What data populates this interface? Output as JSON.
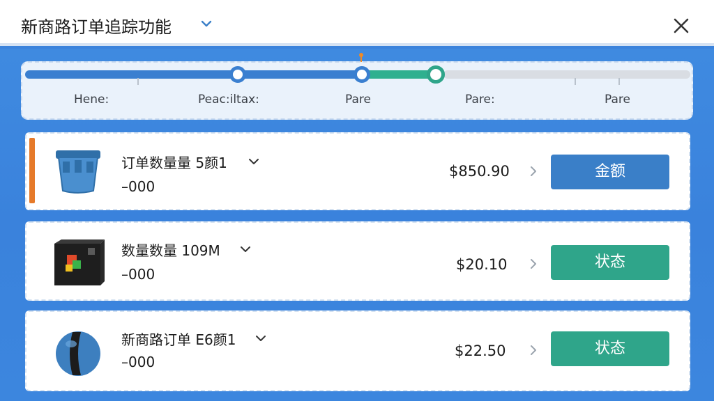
{
  "window": {
    "title": "新商路订单追踪功能"
  },
  "progress": {
    "steps": [
      "Hene:",
      "Peac:iltax:",
      "Pare",
      "Pare:",
      "Pare"
    ]
  },
  "orders": [
    {
      "name": "订单数量量 5颜1",
      "qty": "–000",
      "price": "$850.90",
      "action": "金额",
      "action_color": "#3a7fc8",
      "thumb_icon": "blue-bucket-icon"
    },
    {
      "name": "数量数量 109M",
      "qty": "–000",
      "price": "$20.10",
      "action": "状态",
      "action_color": "#2fa58a",
      "thumb_icon": "black-box-icon"
    },
    {
      "name": "新商路订单 E6颜1",
      "qty": "–000",
      "price": "$22.50",
      "action": "状态",
      "action_color": "#2fa58a",
      "thumb_icon": "blue-ball-icon"
    }
  ],
  "colors": {
    "accent_blue": "#3a7fd0",
    "accent_green": "#2fb08f",
    "highlight_orange": "#e67a2a",
    "background": "#3b83dc"
  }
}
